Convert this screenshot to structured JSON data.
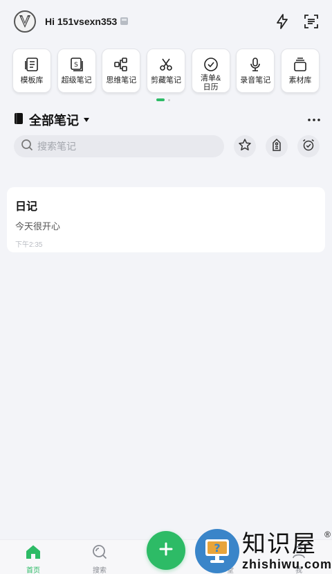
{
  "header": {
    "greeting": "Hi 151vsexn353",
    "avatar_icon": "avatar-logo-icon",
    "actions": [
      {
        "name": "flash-icon"
      },
      {
        "name": "scan-icon"
      }
    ]
  },
  "quick_actions": [
    {
      "label": "模板库",
      "icon": "template-icon"
    },
    {
      "label": "超级笔记",
      "icon": "super-note-icon"
    },
    {
      "label": "思维笔记",
      "icon": "mindmap-icon"
    },
    {
      "label": "剪藏笔记",
      "icon": "scissors-icon"
    },
    {
      "label": "清单&日历",
      "icon": "checklist-icon"
    },
    {
      "label": "录音笔记",
      "icon": "microphone-icon"
    },
    {
      "label": "素材库",
      "icon": "material-icon"
    }
  ],
  "notebook": {
    "title": "全部笔记"
  },
  "search": {
    "placeholder": "搜索笔记"
  },
  "notes": [
    {
      "title": "日记",
      "body": "今天很开心",
      "time": "下午2:35"
    }
  ],
  "tabbar": {
    "home": "首页",
    "search": "搜索",
    "study": "堂",
    "me": "我"
  },
  "watermark": {
    "cn": "知识屋",
    "en": "zhishiwu.com",
    "reg": "®"
  },
  "colors": {
    "accent": "#2dbb66",
    "background": "#f3f4f8",
    "watermark_blue": "#3a85c9"
  }
}
